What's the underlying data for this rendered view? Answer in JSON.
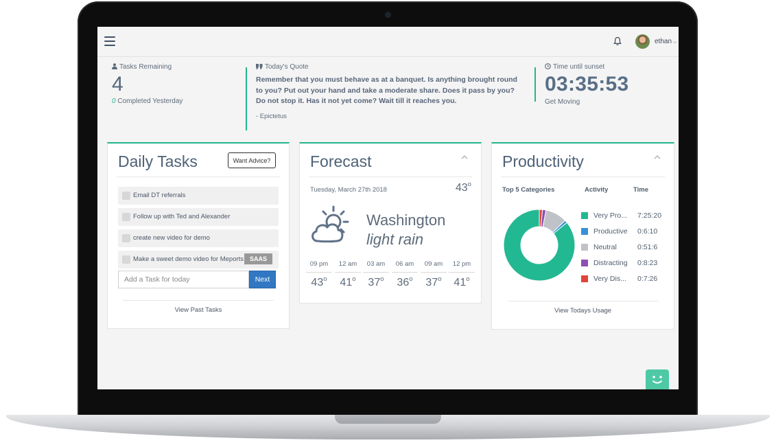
{
  "topbar": {
    "user_name": "ethan"
  },
  "stats": {
    "tasks": {
      "label": "Tasks Remaining",
      "value": "4",
      "completed_count": "0",
      "completed_label": "Completed Yesterday"
    },
    "quote": {
      "label": "Today's Quote",
      "text": "Remember that you must behave as at a banquet. Is anything brought round to you? Put out your hand and take a moderate share. Does it pass by you? Do not stop it. Has it not yet come? Wait till it reaches you.",
      "author": "- Epictetus"
    },
    "sunset": {
      "label": "Time until sunset",
      "value": "03:35:53",
      "sub": "Get Moving"
    }
  },
  "daily_tasks": {
    "title": "Daily Tasks",
    "advice_label": "Want Advice?",
    "tasks": [
      {
        "text": "Email DT referrals"
      },
      {
        "text": "Follow up with Ted and Alexander"
      },
      {
        "text": "create new video for demo"
      },
      {
        "text": "Make a sweet demo video for Meports",
        "tag": "SAAS"
      }
    ],
    "add_placeholder": "Add a Task for today",
    "next_label": "Next",
    "footer_link": "View Past Tasks"
  },
  "forecast": {
    "title": "Forecast",
    "date": "Tuesday, March 27th 2018",
    "current_temp": "43",
    "city": "Washington",
    "condition": "light rain",
    "hourly": [
      {
        "time": "09 pm",
        "temp": "43"
      },
      {
        "time": "12 am",
        "temp": "41"
      },
      {
        "time": "03 am",
        "temp": "37"
      },
      {
        "time": "06 am",
        "temp": "36"
      },
      {
        "time": "09 am",
        "temp": "37"
      },
      {
        "time": "12 pm",
        "temp": "41"
      }
    ]
  },
  "productivity": {
    "title": "Productivity",
    "col_categories": "Top 5 Categories",
    "col_activity": "Activity",
    "col_time": "Time",
    "categories": [
      {
        "name": "Very Pro...",
        "time": "7:25:20",
        "seconds": 26720,
        "color": "#22b892"
      },
      {
        "name": "Productive",
        "time": "0:6:10",
        "seconds": 370,
        "color": "#3a8fd8"
      },
      {
        "name": "Neutral",
        "time": "0:51:6",
        "seconds": 3066,
        "color": "#bfc3c7"
      },
      {
        "name": "Distracting",
        "time": "0:8:23",
        "seconds": 503,
        "color": "#8e4fb3"
      },
      {
        "name": "Very Dis...",
        "time": "0:7:26",
        "seconds": 446,
        "color": "#e0443a"
      }
    ],
    "footer_link": "View Todays Usage"
  }
}
